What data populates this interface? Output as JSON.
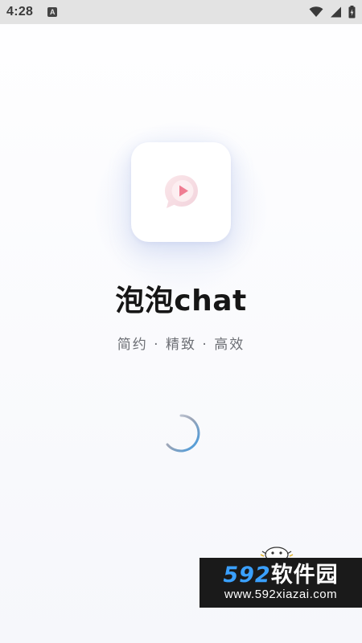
{
  "status_bar": {
    "time": "4:28",
    "notification_badge": "A",
    "icons": [
      "wifi-icon",
      "cellular-signal-icon",
      "battery-icon"
    ]
  },
  "splash": {
    "app_name": "泡泡chat",
    "slogan": "简约 · 精致 · 高效",
    "logo_icon": "play-chat-bubble-icon",
    "loading_indicator": "spinner"
  },
  "watermark": {
    "brand_digits": "592",
    "brand_text": "软件园",
    "url": "www.592xiazai.com"
  },
  "colors": {
    "accent": "#4a9fe0",
    "title": "#161616",
    "slogan": "#6d6f75",
    "logo_bubble": "#f7dde3",
    "logo_play": "#f07f93",
    "watermark_brand": "#3aa0ff"
  }
}
